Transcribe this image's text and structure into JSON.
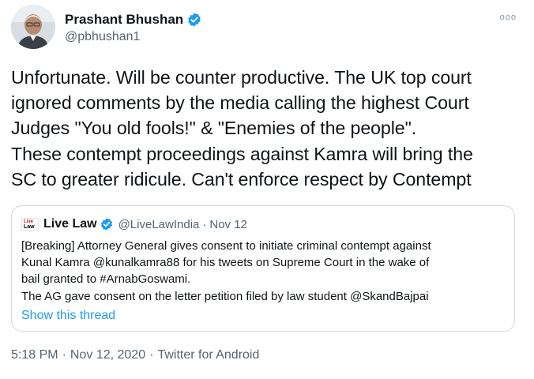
{
  "author": {
    "display_name": "Prashant Bhushan",
    "handle": "@pbhushan1",
    "verified_icon": "verified-badge-icon",
    "more_label": "ooo"
  },
  "tweet": {
    "lines": [
      "Unfortunate. Will be counter productive. The UK top court",
      "ignored comments by the media calling the highest Court",
      "Judges \"You old fools!\" &  \"Enemies of the people\".",
      "These contempt proceedings against Kamra will bring the",
      "SC to greater ridicule. Can't enforce respect by Contempt"
    ]
  },
  "quoted": {
    "logo_line1": "Live",
    "logo_line2": "Law",
    "display_name": "Live Law",
    "handle": "@LiveLawIndia",
    "dot": "·",
    "date": "Nov 12",
    "lines": [
      "[Breaking] Attorney General gives consent to initiate criminal contempt against",
      "Kunal Kamra @kunalkamra88 for his tweets on Supreme Court in the wake of",
      "bail granted to #ArnabGoswami.",
      "The AG gave consent on the letter petition filed by law student @SkandBajpai"
    ],
    "show_thread": "Show this thread"
  },
  "meta": {
    "time": "5:18 PM",
    "sep": "·",
    "date": "Nov 12, 2020",
    "source": "Twitter for Android"
  },
  "colors": {
    "link": "#1d9bf0",
    "secondary": "#536471",
    "border": "#cfd9de"
  }
}
